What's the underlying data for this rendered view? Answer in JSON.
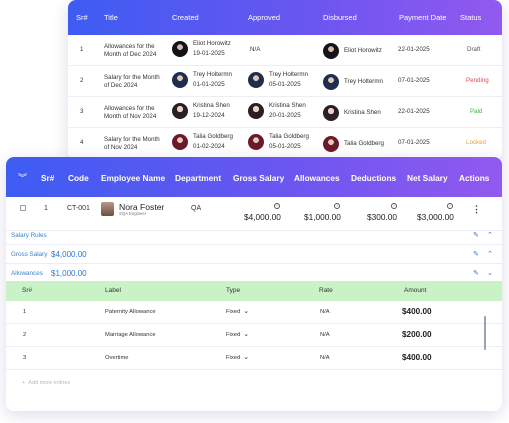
{
  "payroll": {
    "headers": [
      "Sr#",
      "Title",
      "Created",
      "Approved",
      "Disbursed",
      "Payment Date",
      "Status"
    ],
    "rows": [
      {
        "sr": "1",
        "title": "Allowances for the Month of Dec 2024",
        "created_name": "Eliot Horowitz",
        "created_date": "19-01-2025",
        "approved": "N/A",
        "disbursed_name": "Eliot Horowitz",
        "payment_date": "22-01-2025",
        "status": "Draft",
        "status_color": "#555555"
      },
      {
        "sr": "2",
        "title": "Salary for the Month of Dec 2024",
        "created_name": "Trey Holtermn",
        "created_date": "01-01-2025",
        "approved_name": "Trey Holtermn",
        "approved_date": "05-01-2025",
        "disbursed_name": "Trey Holtermn",
        "payment_date": "07-01-2025",
        "status": "Pending",
        "status_color": "#e5484d"
      },
      {
        "sr": "3",
        "title": "Allowances for the Month of Nov 2024",
        "created_name": "Kristina Shen",
        "created_date": "19-12-2024",
        "approved_name": "Kristina Shen",
        "approved_date": "20-01-2025",
        "disbursed_name": "Kristina Shen",
        "payment_date": "22-01-2025",
        "status": "Paid",
        "status_color": "#3cb44b"
      },
      {
        "sr": "4",
        "title": "Salary for the Month of Nov 2024",
        "created_name": "Talia Goldberg",
        "created_date": "01-02-2024",
        "approved_name": "Talia Goldberg",
        "approved_date": "05-01-2025",
        "disbursed_name": "Talia Goldberg",
        "payment_date": "07-01-2025",
        "status": "Locked",
        "status_color": "#e6a23c"
      }
    ]
  },
  "salary": {
    "headers": [
      "Sr#",
      "Code",
      "Employee Name",
      "Department",
      "Gross Salary",
      "Allowances",
      "Deductions",
      "Net Salary",
      "Actions"
    ],
    "employee": {
      "sr": "1",
      "code": "CT-001",
      "name": "Nora Foster",
      "role": "SQA Engineer",
      "department": "QA",
      "gross": "$4,000.00",
      "allowances": "$1,000.00",
      "deductions": "$300.00",
      "net": "$3,000.00"
    },
    "sub_rows": [
      {
        "label": "Salary Rules",
        "value": ""
      },
      {
        "label": "Gross Salary",
        "value": "$4,000.00"
      },
      {
        "label": "Allowances",
        "value": "$1,000.00"
      }
    ],
    "allowance_headers": [
      "Sr#",
      "Label",
      "Type",
      "Rate",
      "Amount"
    ],
    "allowance_rows": [
      {
        "sr": "1",
        "label": "Paternity Allowance",
        "type": "Fixed",
        "rate": "N/A",
        "amount": "$400.00"
      },
      {
        "sr": "2",
        "label": "Marriage Allowance",
        "type": "Fixed",
        "rate": "N/A",
        "amount": "$200.00"
      },
      {
        "sr": "3",
        "label": "Overtime",
        "type": "Fixed",
        "rate": "N/A",
        "amount": "$400.00"
      }
    ],
    "add_more": "Add more entries"
  }
}
